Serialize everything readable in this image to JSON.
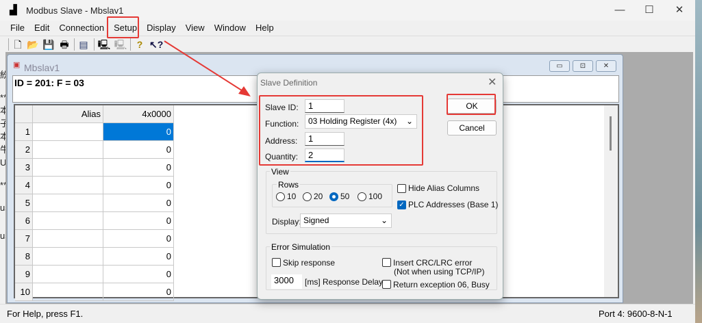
{
  "app": {
    "title": "Modbus Slave - Mbslav1"
  },
  "menu": [
    "File",
    "Edit",
    "Connection",
    "Setup",
    "Display",
    "View",
    "Window",
    "Help"
  ],
  "toolbar": [
    "new-icon",
    "open-icon",
    "save-icon",
    "print-icon",
    "window-icon",
    "connect-icon",
    "disconnect-icon",
    "help-icon",
    "context-help-icon"
  ],
  "background_text": [
    "紛",
    "**",
    "本",
    "子",
    "本",
    "牛",
    "U",
    "**",
    "us",
    "us"
  ],
  "child": {
    "title": "Mbslav1",
    "id_line": "ID = 201: F = 03",
    "columns": [
      "Alias",
      "4x0000"
    ],
    "rows": [
      {
        "n": "1",
        "v": "0"
      },
      {
        "n": "2",
        "v": "0"
      },
      {
        "n": "3",
        "v": "0"
      },
      {
        "n": "4",
        "v": "0"
      },
      {
        "n": "5",
        "v": "0"
      },
      {
        "n": "6",
        "v": "0"
      },
      {
        "n": "7",
        "v": "0"
      },
      {
        "n": "8",
        "v": "0"
      },
      {
        "n": "9",
        "v": "0"
      },
      {
        "n": "10",
        "v": "0"
      }
    ]
  },
  "dialog": {
    "title": "Slave Definition",
    "slave_id_label": "Slave ID:",
    "slave_id": "1",
    "function_label": "Function:",
    "function": "03 Holding Register (4x)",
    "address_label": "Address:",
    "address": "1",
    "quantity_label": "Quantity:",
    "quantity": "2",
    "ok": "OK",
    "cancel": "Cancel",
    "view_label": "View",
    "rows_label": "Rows",
    "rows_options": [
      "10",
      "20",
      "50",
      "100"
    ],
    "rows_selected": "50",
    "hide_alias": "Hide Alias Columns",
    "hide_alias_checked": false,
    "plc_addresses": "PLC Addresses (Base 1)",
    "plc_checked": true,
    "display_label": "Display:",
    "display": "Signed",
    "error_label": "Error Simulation",
    "skip_response": "Skip response",
    "insert_crc": "Insert CRC/LRC error",
    "insert_crc_note": "(Not when using TCP/IP)",
    "delay": "3000",
    "delay_label": "[ms] Response Delay",
    "return_exception": "Return exception 06, Busy"
  },
  "status": {
    "help": "For Help, press F1.",
    "port": "Port 4: 9600-8-N-1"
  },
  "colors": {
    "annotation": "#e53935",
    "selection": "#0078d7"
  }
}
